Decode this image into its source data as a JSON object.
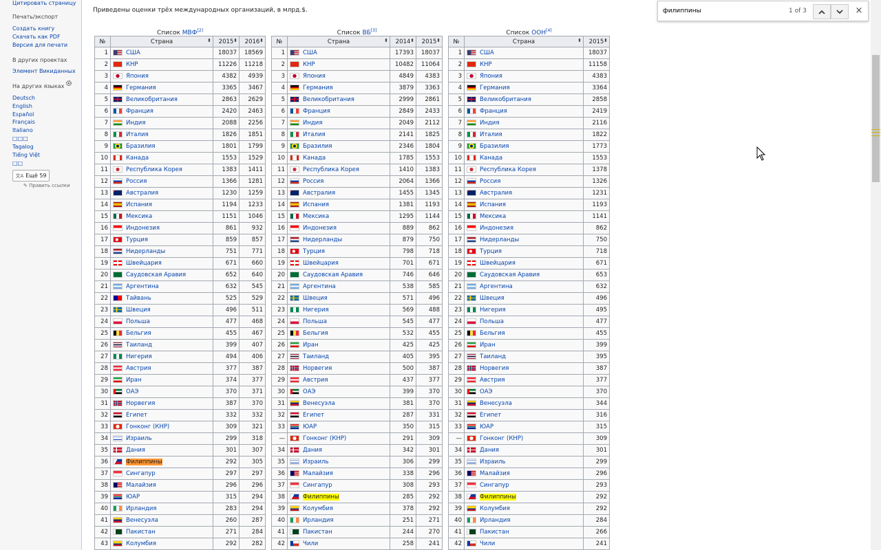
{
  "sidebar": {
    "top_link": "Цитировать страницу",
    "print_heading": "Печать/экспорт",
    "print_links": [
      "Создать книгу",
      "Скачать как PDF",
      "Версия для печати"
    ],
    "projects_heading": "В других проектах",
    "projects_links": [
      "Элемент Викиданных"
    ],
    "languages_heading": "На других языках",
    "languages": [
      "Deutsch",
      "English",
      "Español",
      "Français",
      "Italiano",
      "□□□",
      "Tagalog",
      "Tiếng Việt",
      "□□"
    ],
    "more_button": "Ещё 59",
    "edit_links": "Править ссылки"
  },
  "content": {
    "intro": "Приведены оценки трёх международных организаций, в млрд.$."
  },
  "findbar": {
    "query": "филиппины",
    "count": "1 of 3"
  },
  "tables": [
    {
      "caption_prefix": "Список ",
      "caption_link": "МВФ",
      "caption_ref": "[2]",
      "headers": [
        "№",
        "Страна",
        "2015",
        "2016"
      ],
      "rows": [
        [
          "1",
          "США",
          "18037",
          "18569"
        ],
        [
          "2",
          "КНР",
          "11226",
          "11218"
        ],
        [
          "3",
          "Япония",
          "4382",
          "4939"
        ],
        [
          "4",
          "Германия",
          "3365",
          "3467"
        ],
        [
          "5",
          "Великобритания",
          "2863",
          "2629"
        ],
        [
          "6",
          "Франция",
          "2420",
          "2463"
        ],
        [
          "7",
          "Индия",
          "2088",
          "2256"
        ],
        [
          "8",
          "Италия",
          "1826",
          "1851"
        ],
        [
          "9",
          "Бразилия",
          "1801",
          "1799"
        ],
        [
          "10",
          "Канада",
          "1553",
          "1529"
        ],
        [
          "11",
          "Республика Корея",
          "1383",
          "1411"
        ],
        [
          "12",
          "Россия",
          "1366",
          "1281"
        ],
        [
          "13",
          "Австралия",
          "1230",
          "1259"
        ],
        [
          "14",
          "Испания",
          "1194",
          "1233"
        ],
        [
          "15",
          "Мексика",
          "1151",
          "1046"
        ],
        [
          "16",
          "Индонезия",
          "861",
          "932"
        ],
        [
          "17",
          "Турция",
          "859",
          "857"
        ],
        [
          "18",
          "Нидерланды",
          "751",
          "771"
        ],
        [
          "19",
          "Швейцария",
          "671",
          "660"
        ],
        [
          "20",
          "Саудовская Аравия",
          "652",
          "640"
        ],
        [
          "21",
          "Аргентина",
          "632",
          "545"
        ],
        [
          "22",
          "Тайвань",
          "525",
          "529"
        ],
        [
          "23",
          "Швеция",
          "496",
          "511"
        ],
        [
          "24",
          "Польша",
          "477",
          "468"
        ],
        [
          "25",
          "Бельгия",
          "455",
          "467"
        ],
        [
          "26",
          "Таиланд",
          "399",
          "407"
        ],
        [
          "27",
          "Нигерия",
          "494",
          "406"
        ],
        [
          "28",
          "Австрия",
          "377",
          "387"
        ],
        [
          "29",
          "Иран",
          "374",
          "377"
        ],
        [
          "30",
          "ОАЭ",
          "370",
          "371"
        ],
        [
          "31",
          "Норвегия",
          "387",
          "370"
        ],
        [
          "32",
          "Египет",
          "332",
          "332"
        ],
        [
          "33",
          "Гонконг (КНР)",
          "309",
          "321"
        ],
        [
          "34",
          "Израиль",
          "299",
          "318"
        ],
        [
          "35",
          "Дания",
          "301",
          "307"
        ],
        [
          "36",
          "Филиппины",
          "292",
          "305"
        ],
        [
          "37",
          "Сингапур",
          "297",
          "297"
        ],
        [
          "38",
          "Малайзия",
          "296",
          "296"
        ],
        [
          "39",
          "ЮАР",
          "315",
          "294"
        ],
        [
          "40",
          "Ирландия",
          "283",
          "294"
        ],
        [
          "41",
          "Венесуэла",
          "260",
          "287"
        ],
        [
          "42",
          "Пакистан",
          "271",
          "284"
        ],
        [
          "43",
          "Колумбия",
          "292",
          "282"
        ]
      ]
    },
    {
      "caption_prefix": "Список ",
      "caption_link": "ВБ",
      "caption_ref": "[3]",
      "headers": [
        "№",
        "Страна",
        "2014",
        "2015"
      ],
      "rows": [
        [
          "1",
          "США",
          "17393",
          "18037"
        ],
        [
          "2",
          "КНР",
          "10482",
          "11064"
        ],
        [
          "3",
          "Япония",
          "4849",
          "4383"
        ],
        [
          "4",
          "Германия",
          "3879",
          "3363"
        ],
        [
          "5",
          "Великобритания",
          "2999",
          "2861"
        ],
        [
          "6",
          "Франция",
          "2849",
          "2433"
        ],
        [
          "7",
          "Индия",
          "2049",
          "2112"
        ],
        [
          "8",
          "Италия",
          "2141",
          "1825"
        ],
        [
          "9",
          "Бразилия",
          "2346",
          "1804"
        ],
        [
          "10",
          "Канада",
          "1785",
          "1553"
        ],
        [
          "11",
          "Республика Корея",
          "1410",
          "1383"
        ],
        [
          "12",
          "Россия",
          "2064",
          "1366"
        ],
        [
          "13",
          "Австралия",
          "1455",
          "1345"
        ],
        [
          "14",
          "Испания",
          "1381",
          "1193"
        ],
        [
          "15",
          "Мексика",
          "1295",
          "1144"
        ],
        [
          "16",
          "Индонезия",
          "889",
          "862"
        ],
        [
          "17",
          "Нидерланды",
          "879",
          "750"
        ],
        [
          "18",
          "Турция",
          "798",
          "718"
        ],
        [
          "19",
          "Швейцария",
          "701",
          "671"
        ],
        [
          "20",
          "Саудовская Аравия",
          "746",
          "646"
        ],
        [
          "21",
          "Аргентина",
          "538",
          "585"
        ],
        [
          "22",
          "Швеция",
          "571",
          "496"
        ],
        [
          "23",
          "Нигерия",
          "569",
          "488"
        ],
        [
          "24",
          "Польша",
          "545",
          "477"
        ],
        [
          "25",
          "Бельгия",
          "532",
          "455"
        ],
        [
          "26",
          "Иран",
          "425",
          "425"
        ],
        [
          "27",
          "Таиланд",
          "405",
          "395"
        ],
        [
          "28",
          "Норвегия",
          "500",
          "387"
        ],
        [
          "29",
          "Австрия",
          "437",
          "377"
        ],
        [
          "30",
          "ОАЭ",
          "399",
          "370"
        ],
        [
          "31",
          "Венесуэла",
          "381",
          "370"
        ],
        [
          "32",
          "Египет",
          "287",
          "331"
        ],
        [
          "33",
          "ЮАР",
          "350",
          "315"
        ],
        [
          "—",
          "Гонконг (КНР)",
          "291",
          "309"
        ],
        [
          "34",
          "Дания",
          "342",
          "301"
        ],
        [
          "35",
          "Израиль",
          "306",
          "299"
        ],
        [
          "36",
          "Малайзия",
          "338",
          "296"
        ],
        [
          "37",
          "Сингапур",
          "308",
          "293"
        ],
        [
          "38",
          "Филиппины",
          "285",
          "292"
        ],
        [
          "39",
          "Колумбия",
          "378",
          "292"
        ],
        [
          "40",
          "Ирландия",
          "251",
          "271"
        ],
        [
          "41",
          "Пакистан",
          "244",
          "270"
        ],
        [
          "42",
          "Чили",
          "258",
          "241"
        ]
      ]
    },
    {
      "caption_prefix": "Список ",
      "caption_link": "ООН",
      "caption_ref": "[4]",
      "headers": [
        "№",
        "Страна",
        "2015"
      ],
      "rows": [
        [
          "1",
          "США",
          "18037"
        ],
        [
          "2",
          "КНР",
          "11158"
        ],
        [
          "3",
          "Япония",
          "4383"
        ],
        [
          "4",
          "Германия",
          "3364"
        ],
        [
          "5",
          "Великобритания",
          "2858"
        ],
        [
          "6",
          "Франция",
          "2419"
        ],
        [
          "7",
          "Индия",
          "2116"
        ],
        [
          "8",
          "Италия",
          "1822"
        ],
        [
          "9",
          "Бразилия",
          "1773"
        ],
        [
          "10",
          "Канада",
          "1553"
        ],
        [
          "11",
          "Республика Корея",
          "1378"
        ],
        [
          "12",
          "Россия",
          "1326"
        ],
        [
          "13",
          "Австралия",
          "1231"
        ],
        [
          "14",
          "Испания",
          "1193"
        ],
        [
          "15",
          "Мексика",
          "1141"
        ],
        [
          "16",
          "Индонезия",
          "862"
        ],
        [
          "17",
          "Нидерланды",
          "750"
        ],
        [
          "18",
          "Турция",
          "718"
        ],
        [
          "19",
          "Швейцария",
          "671"
        ],
        [
          "20",
          "Саудовская Аравия",
          "653"
        ],
        [
          "21",
          "Аргентина",
          "632"
        ],
        [
          "22",
          "Швеция",
          "496"
        ],
        [
          "23",
          "Нигерия",
          "495"
        ],
        [
          "24",
          "Польша",
          "477"
        ],
        [
          "25",
          "Бельгия",
          "455"
        ],
        [
          "26",
          "Иран",
          "399"
        ],
        [
          "27",
          "Таиланд",
          "395"
        ],
        [
          "28",
          "Норвегия",
          "387"
        ],
        [
          "29",
          "Австрия",
          "377"
        ],
        [
          "30",
          "ОАЭ",
          "370"
        ],
        [
          "31",
          "Венесуэла",
          "344"
        ],
        [
          "32",
          "Египет",
          "316"
        ],
        [
          "33",
          "ЮАР",
          "315"
        ],
        [
          "—",
          "Гонконг (КНР)",
          "309"
        ],
        [
          "34",
          "Дания",
          "301"
        ],
        [
          "35",
          "Израиль",
          "299"
        ],
        [
          "36",
          "Малайзия",
          "296"
        ],
        [
          "37",
          "Сингапур",
          "293"
        ],
        [
          "38",
          "Филиппины",
          "292"
        ],
        [
          "39",
          "Колумбия",
          "292"
        ],
        [
          "40",
          "Ирландия",
          "284"
        ],
        [
          "41",
          "Пакистан",
          "266"
        ],
        [
          "42",
          "Чили",
          "241"
        ]
      ]
    }
  ],
  "highlight": {
    "term": "Филиппины",
    "current_table": 0,
    "color": "#ffff00",
    "current_color": "#ff9632"
  },
  "flags": {
    "США": "linear-gradient(90deg,#3c3b6e 0 45%,transparent 45%),repeating-linear-gradient(180deg,#b22234 0 1.3px,#fff 1.3px 2.6px)",
    "КНР": "#de2910",
    "Япония": "radial-gradient(circle,#bc002d 0 2.6px,#fff 2.8px)",
    "Германия": "linear-gradient(180deg,#000 0 33%,#dd0000 33% 66%,#ffce00 66%)",
    "Великобритания": "linear-gradient(90deg,transparent 40%,#c8102e 40% 60%,transparent 60%),linear-gradient(180deg,#012169 0 38%,#c8102e 38% 62%,#012169 62%)",
    "Франция": "linear-gradient(90deg,#0055a4 0 33%,#fff 33% 66%,#ef4135 66%)",
    "Индия": "linear-gradient(180deg,#ff9933 0 33%,#fff 33% 66%,#138808 66%)",
    "Италия": "linear-gradient(90deg,#009246 0 33%,#fff 33% 66%,#ce2b37 66%)",
    "Бразилия": "radial-gradient(circle,#002776 0 2px,#ffdf00 2.2px 4px,#009c3b 4.2px)",
    "Канада": "linear-gradient(90deg,#d52b1e 0 26%,#fff 26% 74%,#d52b1e 74%)",
    "Республика Корея": "radial-gradient(circle,#cd2e3a 0 2.5px,#fff 2.7px)",
    "Россия": "linear-gradient(180deg,#fff 0 33%,#0039a6 33% 66%,#d52b1e 66%)",
    "Австралия": "linear-gradient(135deg,#c8102e 0 15%,#012169 15%)",
    "Испания": "linear-gradient(180deg,#aa151b 0 25%,#f1bf00 25% 75%,#aa151b 75%)",
    "Мексика": "linear-gradient(90deg,#006847 0 33%,#fff 33% 66%,#ce1126 66%)",
    "Индонезия": "linear-gradient(180deg,#ff0000 0 50%,#fff 50%)",
    "Турция": "radial-gradient(circle at 40% 50%,#fff 0 2px,#e30a17 2.2px)",
    "Нидерланды": "linear-gradient(180deg,#ae1c28 0 33%,#fff 33% 66%,#21468b 66%)",
    "Швейцария": "linear-gradient(90deg,transparent 42%,#fff 42% 58%,transparent 58%),linear-gradient(180deg,#ff0000 30%,#fff 30% 70%,#ff0000 70%)",
    "Саудовская Аравия": "#006c35",
    "Аргентина": "linear-gradient(180deg,#74acdf 0 33%,#fff 33% 66%,#74acdf 66%)",
    "Тайвань": "linear-gradient(90deg,#000095 0 50%,transparent 50%),#fe0000",
    "Швеция": "linear-gradient(90deg,transparent 30%,#fecc00 30% 44%,transparent 44%),linear-gradient(180deg,#006aa7 40%,#fecc00 40% 60%,#006aa7 60%)",
    "Польша": "linear-gradient(180deg,#fff 0 50%,#dc143c 50%)",
    "Бельгия": "linear-gradient(90deg,#000 0 33%,#fae042 33% 66%,#ed2939 66%)",
    "Таиланд": "linear-gradient(180deg,#a51931 0 16%,#fff 16% 33%,#2d2a4a 33% 66%,#fff 66% 83%,#a51931 83%)",
    "Нигерия": "linear-gradient(90deg,#008751 0 33%,#fff 33% 66%,#008751 66%)",
    "Австрия": "linear-gradient(180deg,#ed2939 0 33%,#fff 33% 66%,#ed2939 66%)",
    "Иран": "linear-gradient(180deg,#239f40 0 33%,#fff 33% 66%,#da0000 66%)",
    "ОАЭ": "linear-gradient(90deg,#ff0000 0 25%,transparent 25%),linear-gradient(180deg,#00732f 0 33%,#fff 33% 66%,#000 66%)",
    "Норвегия": "linear-gradient(90deg,transparent 28%,#fff 28% 32%,#00205b 32% 40%,#fff 40% 44%,transparent 44%),linear-gradient(180deg,#ba0c2f 36%,#fff 36% 40%,#00205b 40% 60%,#fff 60% 64%,#ba0c2f 64%)",
    "Египет": "linear-gradient(180deg,#ce1126 0 33%,#fff 33% 66%,#000 66%)",
    "Гонконг (КНР)": "radial-gradient(circle,#fff 0 2.5px,#de2910 2.7px)",
    "Израиль": "linear-gradient(180deg,#fff 0 15%,#0038b8 15% 25%,#fff 25% 75%,#0038b8 75% 85%,#fff 85%)",
    "Дания": "linear-gradient(90deg,transparent 30%,#fff 30% 42%,transparent 42%),linear-gradient(180deg,#c8102e 40%,#fff 40% 60%,#c8102e 60%)",
    "Филиппины": "linear-gradient(120deg,#fff 0 35%,transparent 35%),linear-gradient(180deg,#0038a8 0 50%,#ce1126 50%)",
    "Сингапур": "linear-gradient(180deg,#ef3340 0 50%,#fff 50%)",
    "Малайзия": "linear-gradient(90deg,#010066 0 45%,transparent 45%),repeating-linear-gradient(180deg,#cc0001 0 1.3px,#fff 1.3px 2.6px)",
    "ЮАР": "linear-gradient(180deg,#de3831 0 38%,#fff 38% 42%,#007a4d 42% 58%,#fff 58% 62%,#002395 62%)",
    "Ирландия": "linear-gradient(90deg,#169b62 0 33%,#fff 33% 66%,#ff883e 66%)",
    "Венесуэла": "linear-gradient(180deg,#ffcc00 0 33%,#00247d 33% 66%,#cf142b 66%)",
    "Пакистан": "linear-gradient(90deg,#fff 0 25%,#01411c 25%)",
    "Колумбия": "linear-gradient(180deg,#fcd116 0 50%,#003893 50% 75%,#ce1126 75%)",
    "Чили": "linear-gradient(90deg,#0039a6 0 35%,transparent 35%),linear-gradient(180deg,#fff 0 50%,#d52b1e 50%)"
  },
  "cursor_icon": "arrow-cursor-icon"
}
